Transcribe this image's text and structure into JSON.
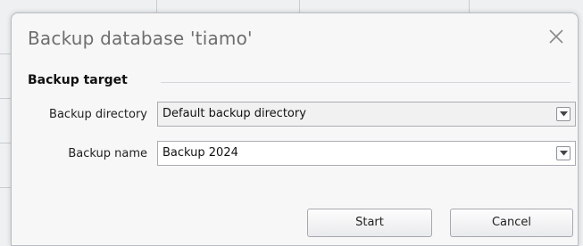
{
  "dialog": {
    "title": "Backup database 'tiamo'",
    "close_icon": "close-icon"
  },
  "backup_target": {
    "group_label": "Backup target",
    "directory_label": "Backup directory",
    "directory_value": "Default backup directory",
    "name_label": "Backup name",
    "name_value": "Backup 2024",
    "dropdown_icon": "chevron-down-icon"
  },
  "buttons": {
    "start": "Start",
    "cancel": "Cancel"
  }
}
